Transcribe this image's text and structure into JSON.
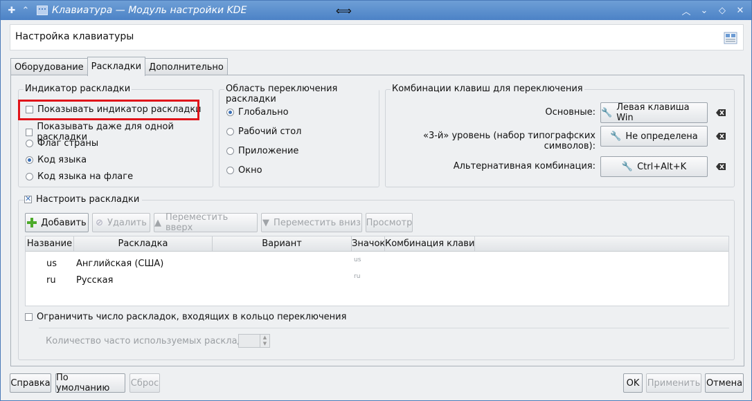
{
  "window": {
    "title": "Клавиатура — Модуль настройки KDE"
  },
  "header": {
    "title": "Настройка клавиатуры"
  },
  "tabs": [
    {
      "label": "Оборудование"
    },
    {
      "label": "Раскладки"
    },
    {
      "label": "Дополнительно"
    }
  ],
  "indicator_group": {
    "title": "Индикатор раскладки",
    "show_indicator": "Показывать индикатор раскладки",
    "show_single": "Показывать даже для одной раскладки",
    "flag": "Флаг страны",
    "lang_code": "Код языка",
    "lang_on_flag": "Код языка на флаге"
  },
  "switch_group": {
    "title": "Область переключения раскладки",
    "global": "Глобально",
    "desktop": "Рабочий стол",
    "application": "Приложение",
    "window": "Окно"
  },
  "shortcuts_group": {
    "title": "Комбинации клавиш для переключения",
    "main_label": "Основные:",
    "main_value": "Левая клавиша Win",
    "third_label": "«3-й» уровень (набор типографских символов):",
    "third_value": "Не определена",
    "alt_label": "Альтернативная комбинация:",
    "alt_value": "Ctrl+Alt+K"
  },
  "layouts": {
    "configure": "Настроить раскладки",
    "add": "Добавить",
    "remove": "Удалить",
    "move_up": "Переместить вверх",
    "move_down": "Переместить вниз",
    "preview": "Просмотр",
    "columns": [
      "Название",
      "Раскладка",
      "Вариант",
      "Значок",
      "Комбинация клавиш"
    ],
    "rows": [
      {
        "name": "us",
        "layout": "Английская (США)",
        "variant": "",
        "icon": "us",
        "shortcut": ""
      },
      {
        "name": "ru",
        "layout": "Русская",
        "variant": "",
        "icon": "ru",
        "shortcut": ""
      }
    ],
    "limit_label": "Ограничить число раскладок, входящих в кольцо переключения",
    "spare_label": "Количество часто используемых раскладок:"
  },
  "footer": {
    "help": "Справка",
    "defaults": "По умолчанию",
    "reset": "Сброс",
    "ok": "OK",
    "apply": "Применить",
    "cancel": "Отмена"
  },
  "colors": {
    "titlebar": "#4c82c6",
    "highlight": "#e0141a"
  }
}
